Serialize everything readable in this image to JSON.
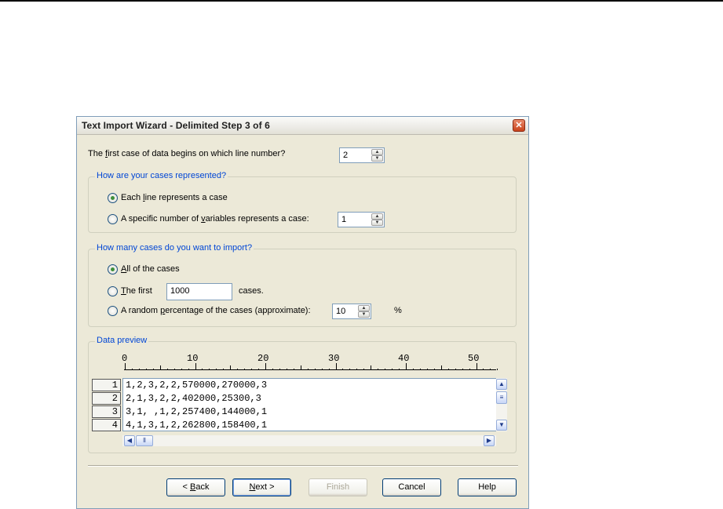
{
  "dialog": {
    "title": "Text Import Wizard - Delimited Step 3 of 6",
    "close_glyph": "✕"
  },
  "first_line": {
    "label_pre": "The ",
    "label_key": "f",
    "label_post": "irst case of data begins on which line number?",
    "value": "2"
  },
  "cases_group": {
    "legend": "How are your cases represented?",
    "option1_pre": "Each ",
    "option1_key": "l",
    "option1_post": "ine represents a case",
    "option2_pre": "A specific number of ",
    "option2_key": "v",
    "option2_post": "ariables represents a case:",
    "option2_value": "1",
    "selected": "option1"
  },
  "import_group": {
    "legend": "How many cases do you want to import?",
    "all_key": "A",
    "all_post": "ll of the cases",
    "first_key": "T",
    "first_post": "he first",
    "first_value": "1000",
    "first_suffix": "cases.",
    "random_pre": "A random ",
    "random_key": "p",
    "random_post": "ercentage of the cases (approximate):",
    "random_value": "10",
    "random_suffix": "%",
    "selected": "all"
  },
  "preview": {
    "legend": "Data preview",
    "ruler_labels": [
      "0",
      "10",
      "20",
      "30",
      "40",
      "50"
    ],
    "rows": [
      {
        "num": "1",
        "text": "1,2,3,2,2,570000,270000,3"
      },
      {
        "num": "2",
        "text": "2,1,3,2,2,402000,25300,3"
      },
      {
        "num": "3",
        "text": "3,1, ,1,2,257400,144000,1"
      },
      {
        "num": "4",
        "text": "4,1,3,1,2,262800,158400,1"
      }
    ]
  },
  "buttons": {
    "back_pre": "< ",
    "back_key": "B",
    "back_post": "ack",
    "next_key": "N",
    "next_post": "ext >",
    "finish": "Finish",
    "cancel": "Cancel",
    "help": "Help"
  }
}
